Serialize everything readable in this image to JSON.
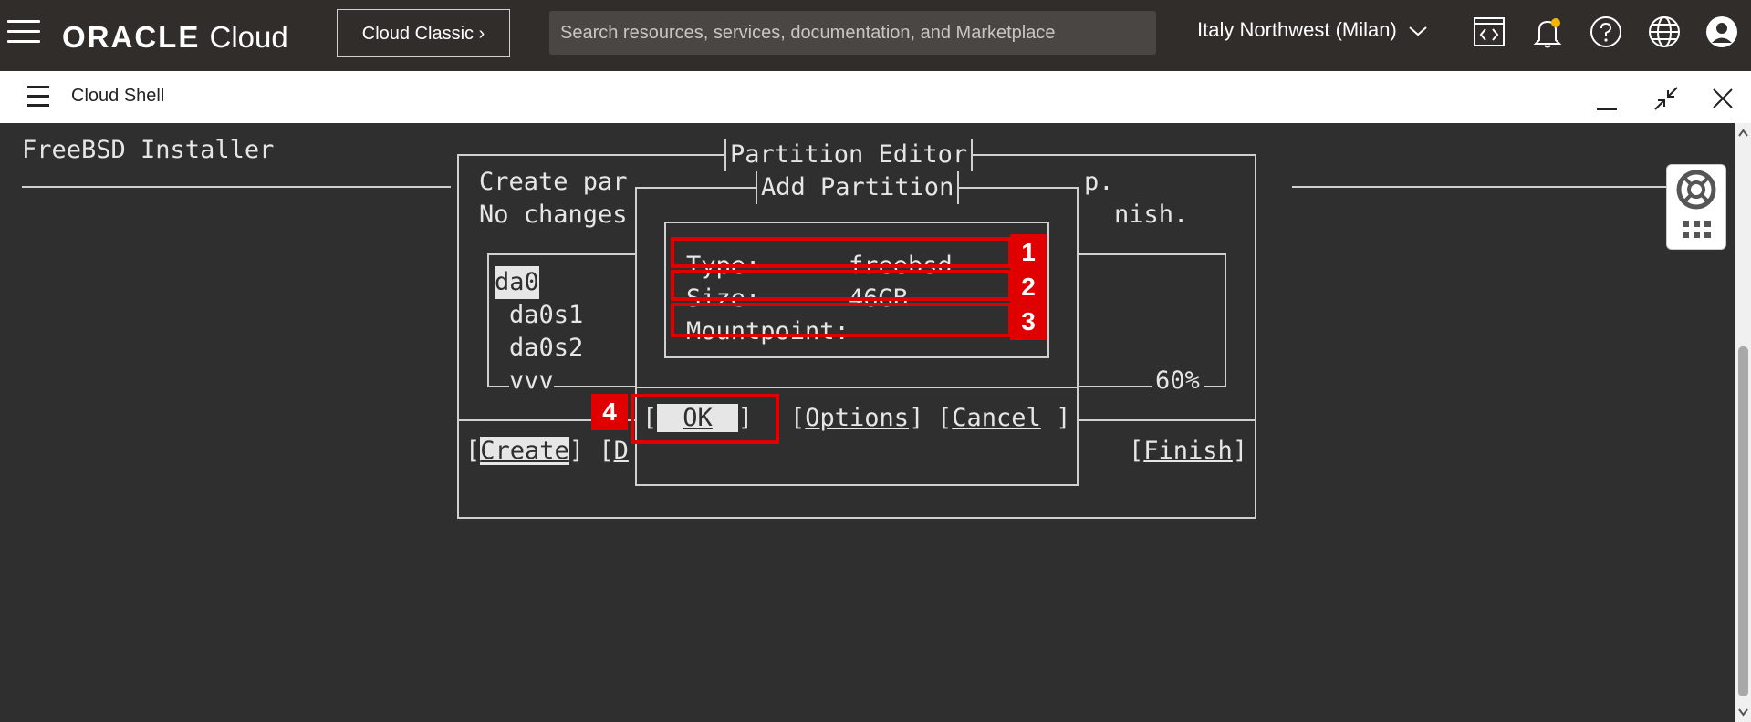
{
  "topbar": {
    "logo_oracle": "ORACLE",
    "logo_cloud": "Cloud",
    "classic_button": "Cloud Classic",
    "search_placeholder": "Search resources, services, documentation, and Marketplace",
    "region": "Italy Northwest (Milan)"
  },
  "shell": {
    "title": "Cloud Shell"
  },
  "terminal": {
    "installer_title": "FreeBSD Installer",
    "partition_editor_title": "Partition Editor",
    "add_partition_title": "Add Partition",
    "bg_line1": "Create par",
    "bg_line1_tail": "p.",
    "bg_line2": "No changes",
    "bg_line2_tail": "nish.",
    "disk_list": [
      "da0",
      "da0s1",
      "da0s2",
      "vvv"
    ],
    "percent": "60%",
    "fields": [
      {
        "label": "Type:",
        "value": "freebsd"
      },
      {
        "label": "Size:",
        "value": "46GB"
      },
      {
        "label": "Mountpoint:",
        "value": ""
      }
    ],
    "buttons": {
      "ok": "OK",
      "options": "Options",
      "cancel": "Cancel"
    },
    "bg_buttons": {
      "create": "Create",
      "d": "D",
      "finish": "Finish"
    }
  },
  "annotations": [
    "1",
    "2",
    "3",
    "4"
  ],
  "colors": {
    "annotation": "#e00000",
    "topbar": "#312d2a",
    "terminal_bg": "#2f2f2f"
  }
}
